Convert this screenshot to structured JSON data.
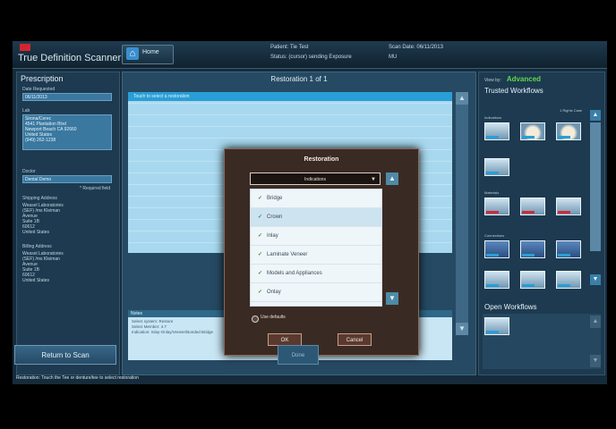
{
  "topbar": {
    "app_name": "True Definition Scanner",
    "home_label": "Home",
    "patient_label": "Patient: Tie Test",
    "status_label": "Status: (cursor) sending Exposure",
    "scan_date_label": "Scan Date: 06/11/2013",
    "extra": "MU"
  },
  "prescription": {
    "title": "Prescription",
    "date_label": "Date Requested",
    "date_value": "06/11/2013",
    "lab_label": "Lab",
    "lab_address": "Sirona/Cerec\n4541 Plantation Blvd\nNewport Beach CA 92660\nUnited States\n(949) 262-1238",
    "doctor_label": "Doctor",
    "doctor_value": "Dental Demo",
    "required_note": "* Required field",
    "shipping_label": "Shipping Address",
    "shipping_address": "Weasel Laboratories\n(SEF) /ms Kleiman\nAvenue\nSuite 1B\n60612\nUnited States",
    "billing_label": "Billing Address",
    "billing_address": "Weasel Laboratories\n(SEF) /ms Kleiman\nAvenue\nSuite 1B\n60612\nUnited States",
    "return_label": "Return to Scan"
  },
  "main": {
    "title": "Restoration 1 of 1",
    "grid_header": "Touch to select a restoration",
    "notes_header": "Notes",
    "notes_text": "Select system: Restore\nSelect Member: 4.7\nIndication: Inlay-Onlay/Veneer/Bonded Bridge",
    "done_label": "Done",
    "status_text": "Restoration: Touch the Tee or denture/tee to select restoration"
  },
  "modal": {
    "title": "Restoration",
    "dropdown_value": "Indications",
    "items": [
      {
        "label": "Bridge",
        "selected": false
      },
      {
        "label": "Crown",
        "selected": true
      },
      {
        "label": "Inlay",
        "selected": false
      },
      {
        "label": "Laminate Veneer",
        "selected": false
      },
      {
        "label": "Models and Appliances",
        "selected": false
      },
      {
        "label": "Onlay",
        "selected": false
      }
    ],
    "defaults_label": "Use defaults",
    "ok_label": "OK",
    "cancel_label": "Cancel"
  },
  "workflows": {
    "view_label": "View by:",
    "view_value": "Advanced",
    "title": "Trusted Workflows",
    "select_label": "1 Rights Case",
    "indications_label": "Indications",
    "materials_label": "Materials",
    "connections_label": "Connections",
    "open_title": "Open Workflows"
  }
}
